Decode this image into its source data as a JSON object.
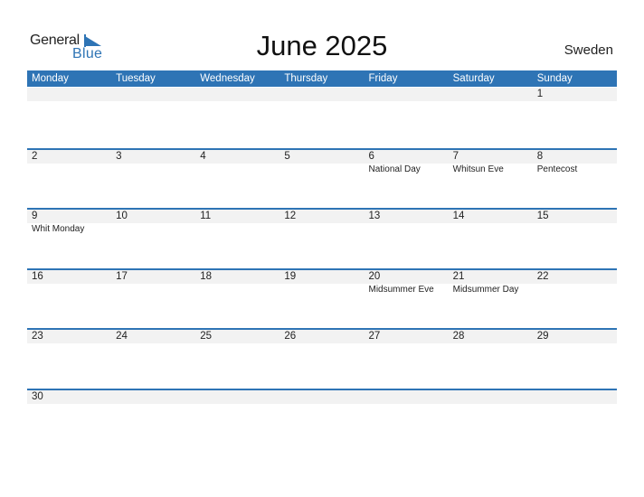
{
  "logo": {
    "general": "General",
    "blue": "Blue"
  },
  "title": "June 2025",
  "country": "Sweden",
  "colors": {
    "accent": "#2e74b5",
    "band": "#f2f2f2"
  },
  "weekdays": [
    "Monday",
    "Tuesday",
    "Wednesday",
    "Thursday",
    "Friday",
    "Saturday",
    "Sunday"
  ],
  "weeks": [
    [
      {
        "day": "",
        "holiday": ""
      },
      {
        "day": "",
        "holiday": ""
      },
      {
        "day": "",
        "holiday": ""
      },
      {
        "day": "",
        "holiday": ""
      },
      {
        "day": "",
        "holiday": ""
      },
      {
        "day": "",
        "holiday": ""
      },
      {
        "day": "1",
        "holiday": ""
      }
    ],
    [
      {
        "day": "2",
        "holiday": ""
      },
      {
        "day": "3",
        "holiday": ""
      },
      {
        "day": "4",
        "holiday": ""
      },
      {
        "day": "5",
        "holiday": ""
      },
      {
        "day": "6",
        "holiday": "National Day"
      },
      {
        "day": "7",
        "holiday": "Whitsun Eve"
      },
      {
        "day": "8",
        "holiday": "Pentecost"
      }
    ],
    [
      {
        "day": "9",
        "holiday": "Whit Monday"
      },
      {
        "day": "10",
        "holiday": ""
      },
      {
        "day": "11",
        "holiday": ""
      },
      {
        "day": "12",
        "holiday": ""
      },
      {
        "day": "13",
        "holiday": ""
      },
      {
        "day": "14",
        "holiday": ""
      },
      {
        "day": "15",
        "holiday": ""
      }
    ],
    [
      {
        "day": "16",
        "holiday": ""
      },
      {
        "day": "17",
        "holiday": ""
      },
      {
        "day": "18",
        "holiday": ""
      },
      {
        "day": "19",
        "holiday": ""
      },
      {
        "day": "20",
        "holiday": "Midsummer Eve"
      },
      {
        "day": "21",
        "holiday": "Midsummer Day"
      },
      {
        "day": "22",
        "holiday": ""
      }
    ],
    [
      {
        "day": "23",
        "holiday": ""
      },
      {
        "day": "24",
        "holiday": ""
      },
      {
        "day": "25",
        "holiday": ""
      },
      {
        "day": "26",
        "holiday": ""
      },
      {
        "day": "27",
        "holiday": ""
      },
      {
        "day": "28",
        "holiday": ""
      },
      {
        "day": "29",
        "holiday": ""
      }
    ],
    [
      {
        "day": "30",
        "holiday": ""
      },
      {
        "day": "",
        "holiday": ""
      },
      {
        "day": "",
        "holiday": ""
      },
      {
        "day": "",
        "holiday": ""
      },
      {
        "day": "",
        "holiday": ""
      },
      {
        "day": "",
        "holiday": ""
      },
      {
        "day": "",
        "holiday": ""
      }
    ]
  ]
}
